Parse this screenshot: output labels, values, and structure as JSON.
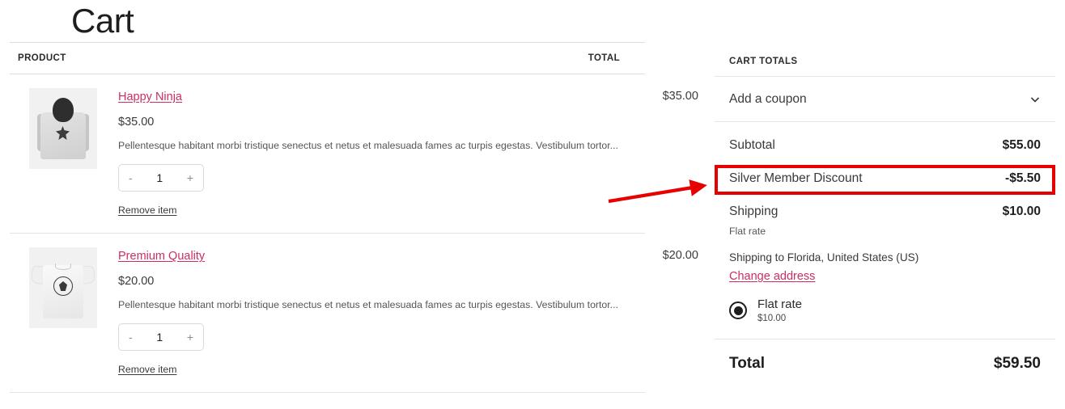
{
  "page": {
    "title": "Cart"
  },
  "cart_table": {
    "headers": {
      "product": "PRODUCT",
      "total": "TOTAL"
    },
    "rows": [
      {
        "name": "Happy Ninja",
        "price": "$35.00",
        "description": "Pellentesque habitant morbi tristique senectus et netus et malesuada fames ac turpis egestas. Vestibulum tortor...",
        "quantity": "1",
        "decrement_label": "-",
        "increment_label": "+",
        "remove_label": "Remove item",
        "line_total": "$35.00",
        "thumbnail": "hoodie-product-image"
      },
      {
        "name": "Premium Quality",
        "price": "$20.00",
        "description": "Pellentesque habitant morbi tristique senectus et netus et malesuada fames ac turpis egestas. Vestibulum tortor...",
        "quantity": "1",
        "decrement_label": "-",
        "increment_label": "+",
        "remove_label": "Remove item",
        "line_total": "$20.00",
        "thumbnail": "tshirt-product-image"
      }
    ]
  },
  "cart_totals": {
    "title": "CART TOTALS",
    "coupon": {
      "label": "Add a coupon",
      "icon": "chevron-down-icon"
    },
    "subtotal": {
      "label": "Subtotal",
      "value": "$55.00"
    },
    "discount": {
      "label": "Silver Member Discount",
      "value": "-$5.50"
    },
    "shipping": {
      "label": "Shipping",
      "value": "$10.00",
      "method": "Flat rate",
      "destination": "Shipping to Florida, United States (US)",
      "change_address_label": "Change address"
    },
    "shipping_option": {
      "name": "Flat rate",
      "price": "$10.00",
      "selected": true
    },
    "total": {
      "label": "Total",
      "value": "$59.50"
    }
  },
  "annotations": {
    "highlight_color": "#e60000",
    "arrow_color": "#e60000",
    "highlighted_row": "Silver Member Discount"
  },
  "colors": {
    "accent_link": "#cc2e63",
    "text_primary": "#1e1e1e",
    "text_secondary": "#555555",
    "border": "#e4e4e4",
    "annotation_red": "#e60000"
  }
}
